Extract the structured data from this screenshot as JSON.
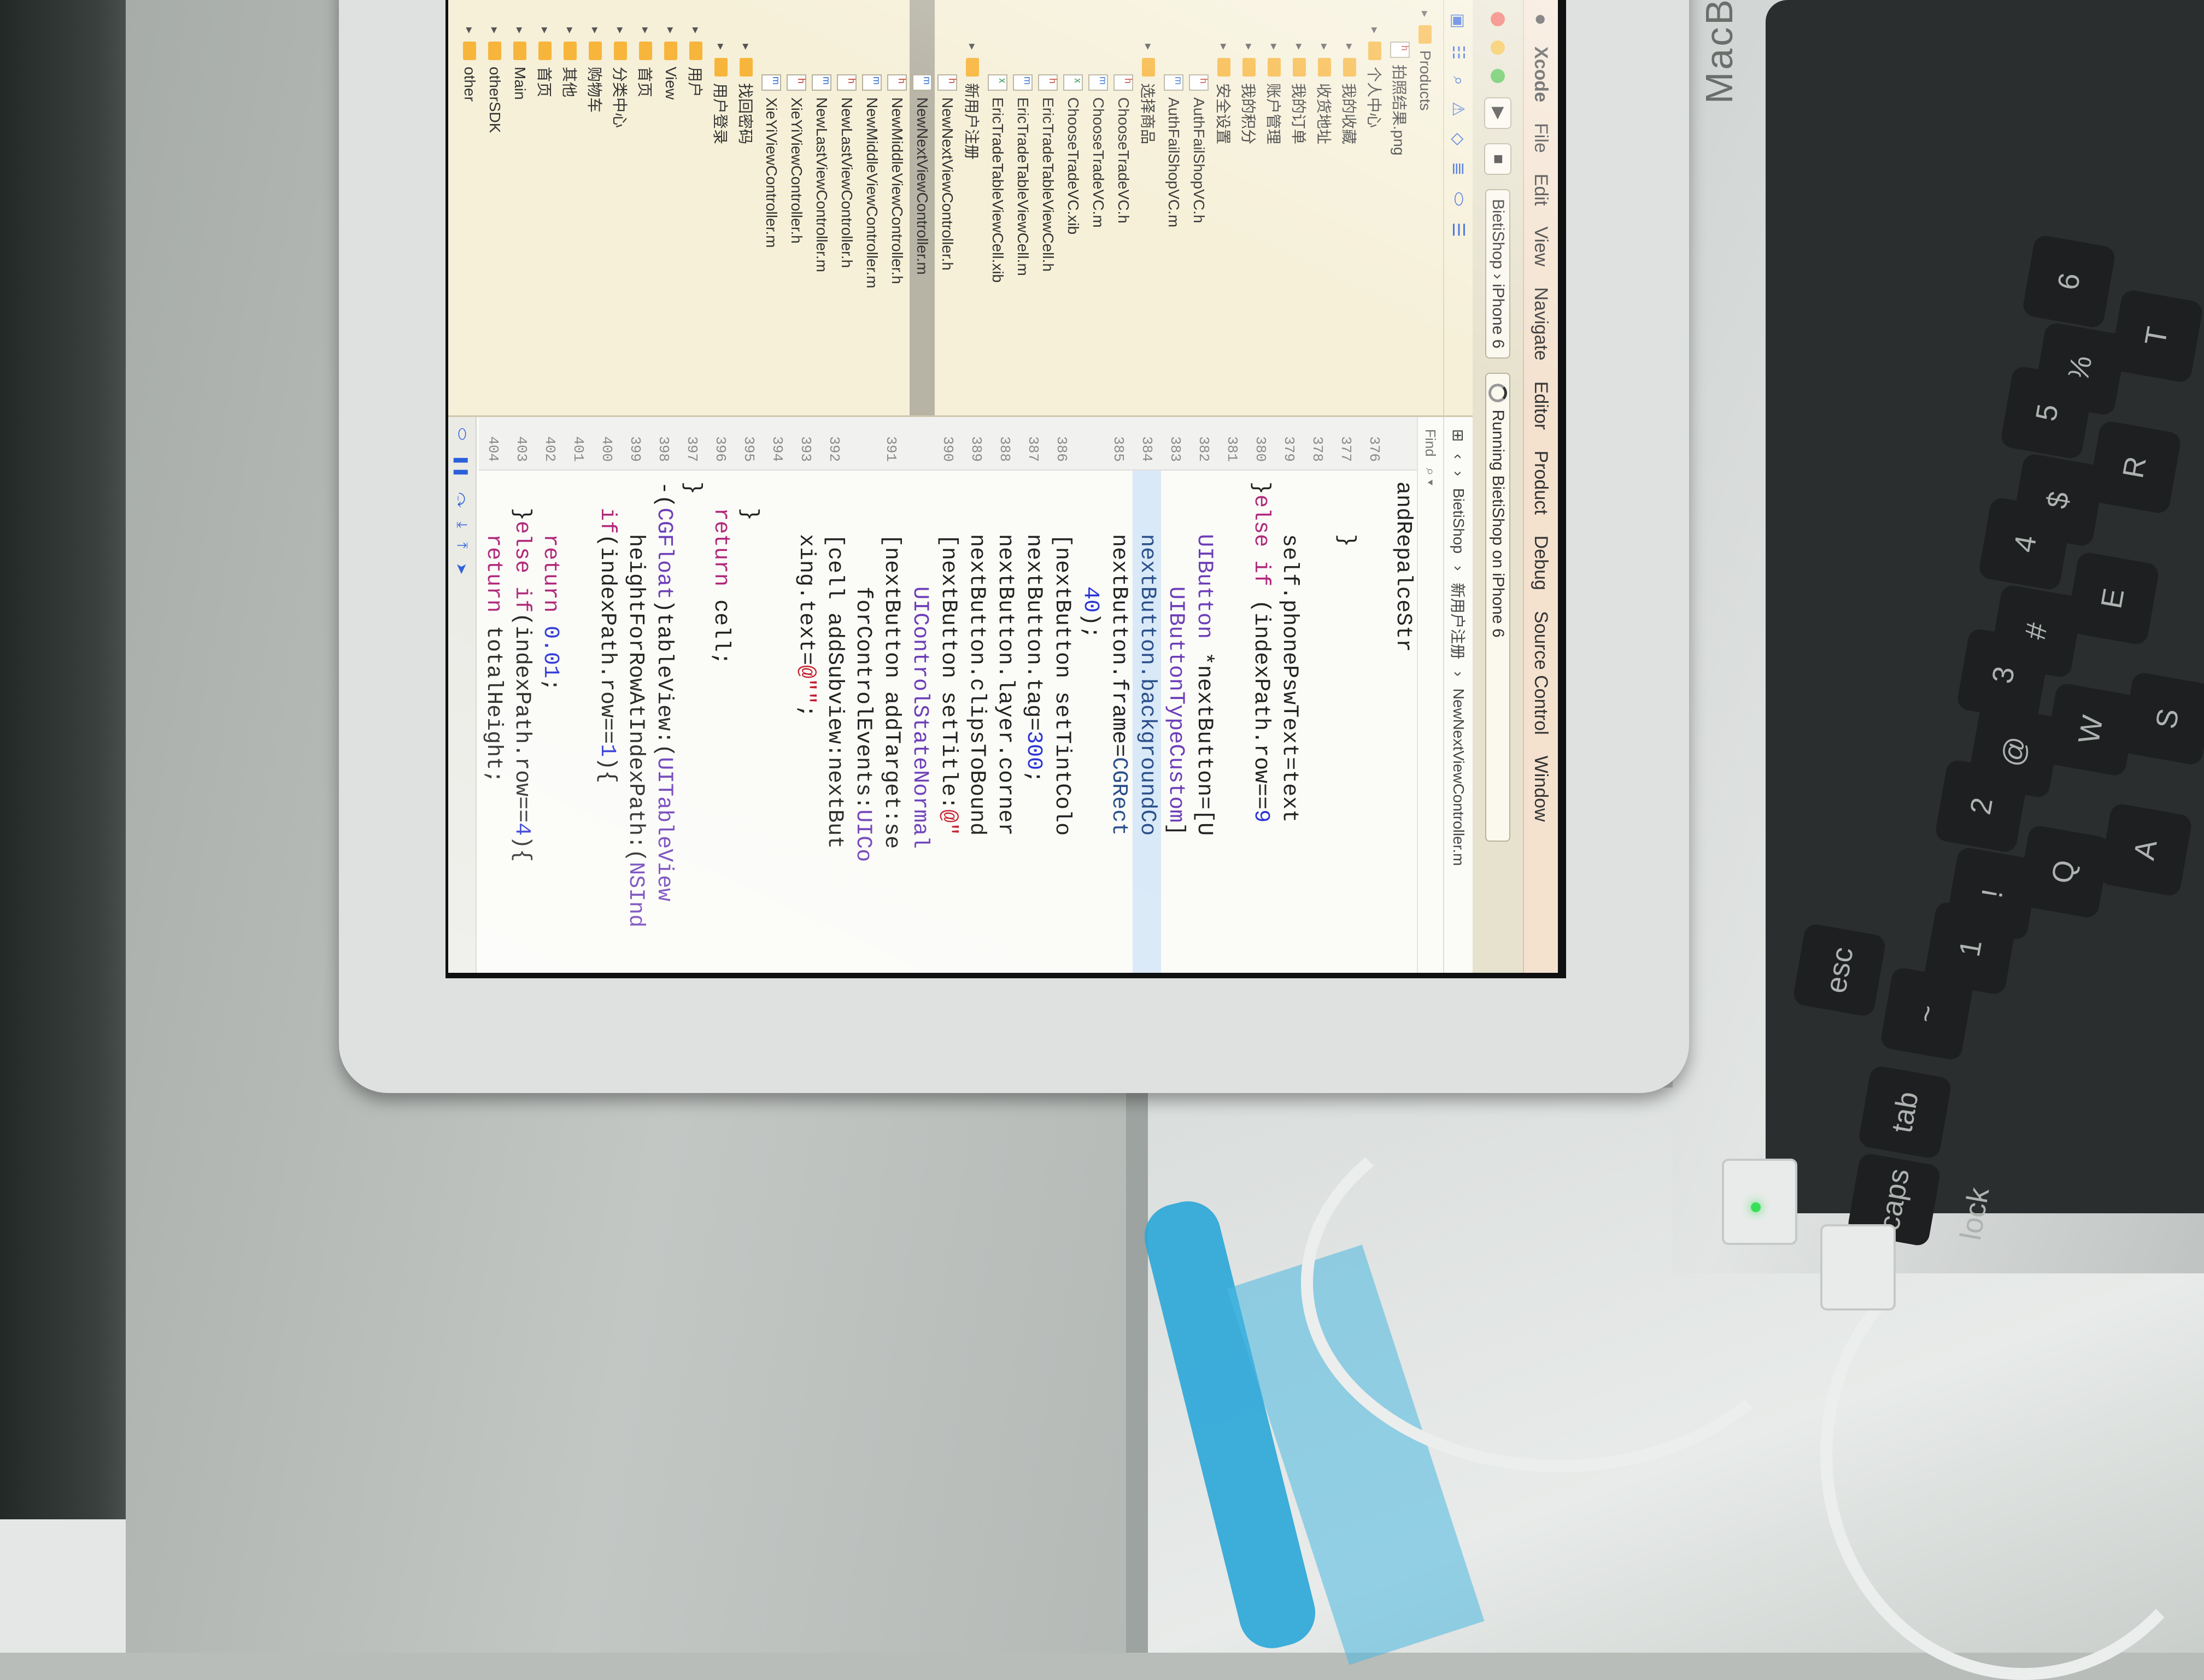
{
  "menubar": {
    "apple": "",
    "items": [
      "Xcode",
      "File",
      "Edit",
      "View",
      "Navigate",
      "Editor",
      "Product",
      "Debug",
      "Source Control",
      "Window"
    ]
  },
  "toolbar": {
    "run_icon": "play-icon",
    "stop_icon": "stop-icon",
    "scheme": "BietiShop",
    "destination": "iPhone 6",
    "activity": "Running BietiShop on iPhone 6"
  },
  "navigator": {
    "tree": [
      {
        "kind": "folder",
        "label": "Products",
        "indent": 0
      },
      {
        "kind": "file-h",
        "label": "拍照结果.png",
        "indent": 1
      },
      {
        "kind": "folder",
        "label": "个人中心",
        "indent": 1
      },
      {
        "kind": "folder",
        "label": "我的收藏",
        "indent": 2
      },
      {
        "kind": "folder",
        "label": "收货地址",
        "indent": 2
      },
      {
        "kind": "folder",
        "label": "我的订单",
        "indent": 2
      },
      {
        "kind": "folder",
        "label": "账户管理",
        "indent": 2
      },
      {
        "kind": "folder",
        "label": "我的积分",
        "indent": 2
      },
      {
        "kind": "folder",
        "label": "安全设置",
        "indent": 2
      },
      {
        "kind": "file-h",
        "label": "AuthFailShopVC.h",
        "indent": 3
      },
      {
        "kind": "file-m",
        "label": "AuthFailShopVC.m",
        "indent": 3
      },
      {
        "kind": "folder",
        "label": "选择商品",
        "indent": 2
      },
      {
        "kind": "file-h",
        "label": "ChooseTradeVC.h",
        "indent": 3
      },
      {
        "kind": "file-m",
        "label": "ChooseTradeVC.m",
        "indent": 3
      },
      {
        "kind": "file-x",
        "label": "ChooseTradeVC.xib",
        "indent": 3
      },
      {
        "kind": "file-h",
        "label": "EricTradeTableViewCell.h",
        "indent": 3
      },
      {
        "kind": "file-m",
        "label": "EricTradeTableViewCell.m",
        "indent": 3
      },
      {
        "kind": "file-x",
        "label": "EricTradeTableViewCell.xib",
        "indent": 3
      },
      {
        "kind": "folder",
        "label": "新用户注册",
        "indent": 2
      },
      {
        "kind": "file-h",
        "label": "NewNextViewController.h",
        "indent": 3
      },
      {
        "kind": "file-m",
        "label": "NewNextViewController.m",
        "indent": 3,
        "selected": true
      },
      {
        "kind": "file-h",
        "label": "NewMiddleViewController.h",
        "indent": 3
      },
      {
        "kind": "file-m",
        "label": "NewMiddleViewController.m",
        "indent": 3
      },
      {
        "kind": "file-h",
        "label": "NewLastViewController.h",
        "indent": 3
      },
      {
        "kind": "file-m",
        "label": "NewLastViewController.m",
        "indent": 3
      },
      {
        "kind": "file-h",
        "label": "XieYiViewController.h",
        "indent": 3
      },
      {
        "kind": "file-m",
        "label": "XieYiViewController.m",
        "indent": 3
      },
      {
        "kind": "folder",
        "label": "找回密码",
        "indent": 2
      },
      {
        "kind": "folder",
        "label": "用户登录",
        "indent": 2
      },
      {
        "kind": "folder",
        "label": "用户",
        "indent": 1
      },
      {
        "kind": "folder",
        "label": "View",
        "indent": 1
      },
      {
        "kind": "folder",
        "label": "首页",
        "indent": 1
      },
      {
        "kind": "folder",
        "label": "分类中心",
        "indent": 1
      },
      {
        "kind": "folder",
        "label": "购物车",
        "indent": 1
      },
      {
        "kind": "folder",
        "label": "其他",
        "indent": 1
      },
      {
        "kind": "folder",
        "label": "首页",
        "indent": 1
      },
      {
        "kind": "folder",
        "label": "Main",
        "indent": 1
      },
      {
        "kind": "folder",
        "label": "otherSDK",
        "indent": 1
      },
      {
        "kind": "folder",
        "label": "other",
        "indent": 1
      }
    ]
  },
  "editor": {
    "jumpbar": [
      "BietiShop",
      "新用户注册",
      "NewNextViewController.m"
    ],
    "find_label": "Find",
    "lines": [
      {
        "n": "",
        "code": [
          [
            "",
            "andRepalceStr"
          ]
        ]
      },
      {
        "n": "376",
        "code": [
          [
            "",
            ""
          ]
        ]
      },
      {
        "n": "377",
        "code": [
          [
            "",
            "    }"
          ]
        ]
      },
      {
        "n": "378",
        "code": [
          [
            "",
            ""
          ]
        ]
      },
      {
        "n": "379",
        "code": [
          [
            "",
            "    self.phonePswText=text"
          ]
        ]
      },
      {
        "n": "380",
        "code": [
          [
            "",
            "}"
          ],
          [
            "kw",
            "else if"
          ],
          [
            "",
            " (indexPath.row=="
          ],
          [
            "num",
            "9"
          ]
        ]
      },
      {
        "n": "381",
        "code": [
          [
            "",
            ""
          ]
        ]
      },
      {
        "n": "382",
        "code": [
          [
            "ty",
            "    UIButton"
          ],
          [
            "",
            " *nextButton=[U"
          ]
        ]
      },
      {
        "n": "383",
        "code": [
          [
            "ty",
            "        UIButtonTypeCustom"
          ],
          [
            "",
            "]"
          ]
        ]
      },
      {
        "n": "384",
        "code": [
          [
            "fn",
            "    nextButton.backgroundCo"
          ]
        ],
        "hl": true
      },
      {
        "n": "385",
        "code": [
          [
            "",
            "    nextButton.frame="
          ],
          [
            "fn",
            "CGRect"
          ]
        ]
      },
      {
        "n": "",
        "code": [
          [
            "num",
            "        40"
          ],
          [
            "",
            ");"
          ]
        ]
      },
      {
        "n": "386",
        "code": [
          [
            "",
            "    [nextButton setTintColo"
          ]
        ]
      },
      {
        "n": "387",
        "code": [
          [
            "",
            "    nextButton.tag="
          ],
          [
            "num",
            "300"
          ],
          [
            "",
            ";"
          ]
        ]
      },
      {
        "n": "388",
        "code": [
          [
            "",
            "    nextButton.layer.corner"
          ]
        ]
      },
      {
        "n": "389",
        "code": [
          [
            "",
            "    nextButton.clipsToBound"
          ]
        ]
      },
      {
        "n": "390",
        "code": [
          [
            "",
            "    [nextButton setTitle:"
          ],
          [
            "str",
            "@\""
          ]
        ]
      },
      {
        "n": "",
        "code": [
          [
            "ty",
            "        UIControlStateNormal"
          ]
        ]
      },
      {
        "n": "391",
        "code": [
          [
            "",
            "    [nextButton addTarget:se"
          ]
        ]
      },
      {
        "n": "",
        "code": [
          [
            "",
            "        forControlEvents:"
          ],
          [
            "ty",
            "UICo"
          ]
        ]
      },
      {
        "n": "392",
        "code": [
          [
            "",
            "    [cell addSubview:nextBut"
          ]
        ]
      },
      {
        "n": "393",
        "code": [
          [
            "",
            "    xing.text="
          ],
          [
            "str",
            "@\"\""
          ],
          [
            "",
            ";"
          ]
        ]
      },
      {
        "n": "394",
        "code": [
          [
            "",
            ""
          ]
        ]
      },
      {
        "n": "395",
        "code": [
          [
            "",
            "  }"
          ]
        ]
      },
      {
        "n": "396",
        "code": [
          [
            "kw",
            "  return"
          ],
          [
            "",
            " cell;"
          ]
        ]
      },
      {
        "n": "397",
        "code": [
          [
            "",
            "}"
          ]
        ]
      },
      {
        "n": "398",
        "code": [
          [
            "",
            "-("
          ],
          [
            "ty",
            "CGFloat"
          ],
          [
            "",
            ")tableView:("
          ],
          [
            "ty",
            "UITableView"
          ]
        ]
      },
      {
        "n": "399",
        "code": [
          [
            "",
            "    heightForRowAtIndexPath:("
          ],
          [
            "ty",
            "NSInd"
          ]
        ]
      },
      {
        "n": "400",
        "code": [
          [
            "kw",
            "  if"
          ],
          [
            "",
            "(indexPath.row=="
          ],
          [
            "num",
            "1"
          ],
          [
            "",
            "){"
          ]
        ]
      },
      {
        "n": "401",
        "code": [
          [
            "",
            ""
          ]
        ]
      },
      {
        "n": "402",
        "code": [
          [
            "kw",
            "    return"
          ],
          [
            "num",
            " 0.01"
          ],
          [
            "",
            ";"
          ]
        ]
      },
      {
        "n": "403",
        "code": [
          [
            "",
            "  }"
          ],
          [
            "kw",
            "else if"
          ],
          [
            "",
            "(indexPath.row=="
          ],
          [
            "num",
            "4"
          ],
          [
            "",
            "){"
          ]
        ]
      },
      {
        "n": "404",
        "code": [
          [
            "kw",
            "    return"
          ],
          [
            "",
            " totalHeight;"
          ]
        ]
      }
    ]
  },
  "laptop": {
    "brand": "MacBook",
    "keys": [
      "esc",
      "~",
      "!",
      "@",
      "#",
      "$",
      "%",
      "tab",
      "Q",
      "W",
      "E",
      "R",
      "T",
      "caps lock",
      "A",
      "S",
      "1",
      "2",
      "3",
      "4",
      "5",
      "6"
    ]
  },
  "colors": {
    "menubar": "#f4e2cf",
    "navigator": "#f6f0d8",
    "editor": "#fbfbf8",
    "folder": "#f7b53c",
    "keyword": "#b0287a",
    "type": "#6c3db8",
    "number": "#2b34d6",
    "string": "#c4202d"
  }
}
